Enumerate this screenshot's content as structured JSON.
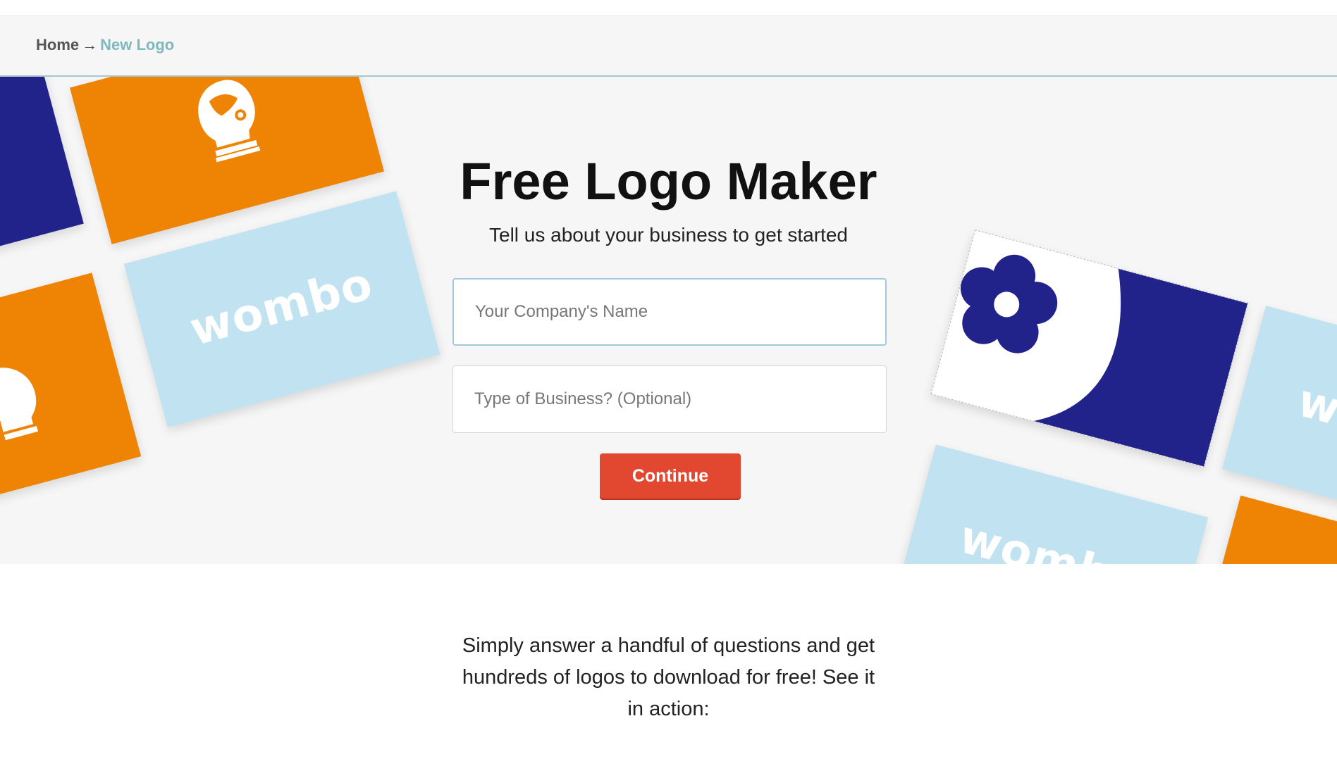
{
  "breadcrumb": {
    "home": "Home",
    "separator": "→",
    "current": "New Logo"
  },
  "hero": {
    "title": "Free Logo Maker",
    "subtitle": "Tell us about your business to get started",
    "company_placeholder": "Your Company's Name",
    "business_placeholder": "Type of Business? (Optional)",
    "continue_label": "Continue",
    "card_word": "wombo",
    "card_word_partial": "w",
    "card_word_bottom": "wombo"
  },
  "below": {
    "text": "Simply answer a handful of questions and get hundreds of logos to download for free! See it in action:"
  },
  "colors": {
    "navy": "#22228b",
    "orange": "#ee8304",
    "light_blue": "#c1e3f1",
    "button": "#e2482f",
    "breadcrumb_current": "#7fb8bf"
  },
  "icons": [
    "astronaut-helmet-icon",
    "flower-icon"
  ]
}
